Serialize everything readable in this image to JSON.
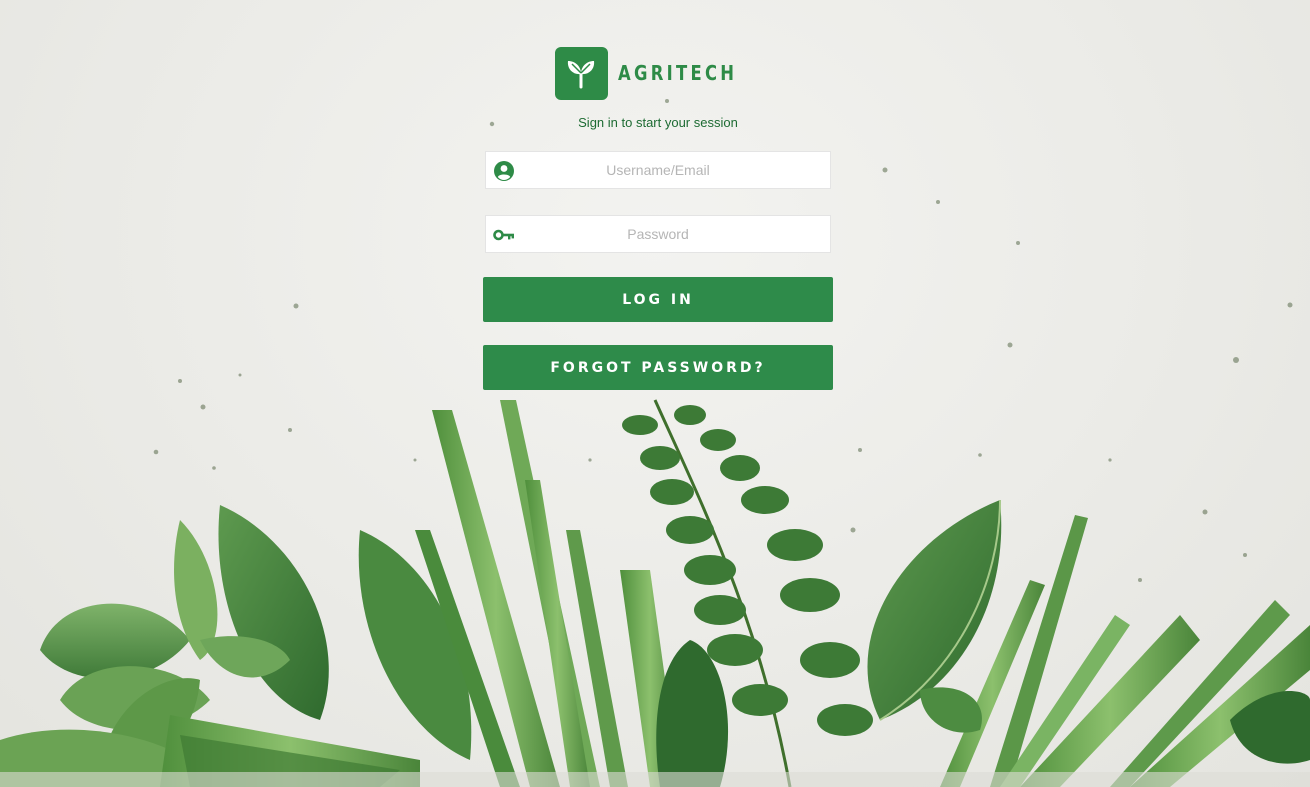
{
  "brand": {
    "name": "AGRITECH",
    "logo_icon": "sprout-icon",
    "accent_color": "#2e8b47"
  },
  "tagline": "Sign in to start your session",
  "form": {
    "username": {
      "placeholder": "Username/Email",
      "value": "",
      "icon": "user-circle-icon"
    },
    "password": {
      "placeholder": "Password",
      "value": "",
      "icon": "key-icon"
    }
  },
  "buttons": {
    "login_label": "LOG IN",
    "forgot_label": "FORGOT PASSWORD?"
  }
}
